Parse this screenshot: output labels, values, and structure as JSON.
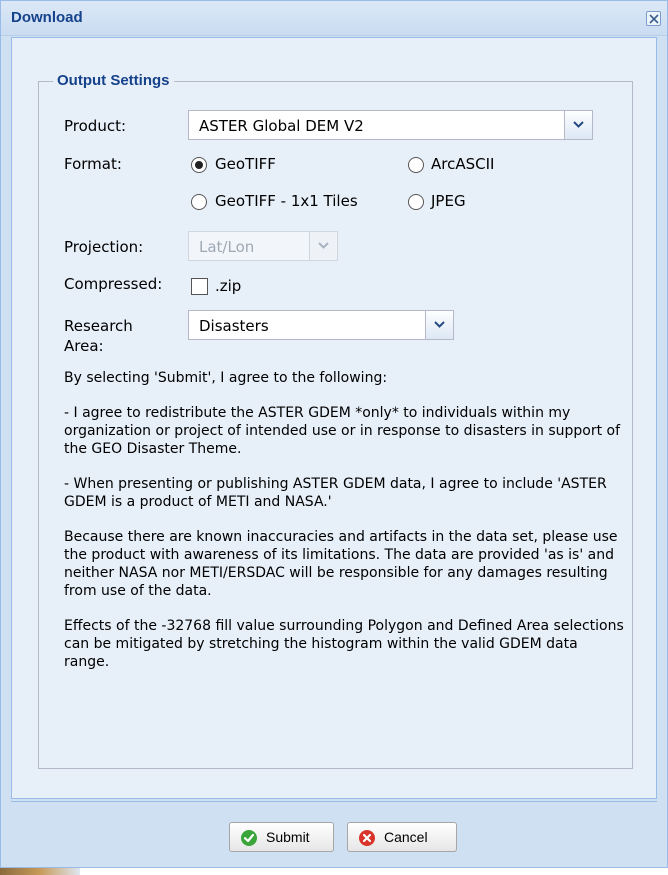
{
  "window": {
    "title": "Download",
    "close_icon": "close-icon"
  },
  "fieldset": {
    "legend": "Output Settings"
  },
  "product": {
    "label": "Product:",
    "value": "ASTER Global DEM V2"
  },
  "format": {
    "label": "Format:",
    "options": [
      {
        "label": "GeoTIFF",
        "selected": true
      },
      {
        "label": "ArcASCII",
        "selected": false
      },
      {
        "label": "GeoTIFF - 1x1 Tiles",
        "selected": false
      },
      {
        "label": "JPEG",
        "selected": false
      }
    ]
  },
  "projection": {
    "label": "Projection:",
    "value": "Lat/Lon",
    "disabled": true
  },
  "compressed": {
    "label": "Compressed:",
    "option_label": ".zip",
    "checked": false
  },
  "research_area": {
    "label_line1": "Research",
    "label_line2": "Area:",
    "value": "Disasters"
  },
  "agreement": [
    "By selecting 'Submit', I agree to the following:",
    "- I agree to redistribute the ASTER GDEM *only* to individuals within my organization or project of intended use or in response to disasters in support of the GEO Disaster Theme.",
    "- When presenting or publishing ASTER GDEM data, I agree to include 'ASTER GDEM is a product of METI and NASA.'",
    "Because there are known inaccuracies and artifacts in the data set, please use the product with awareness of its limitations. The data are provided 'as is' and neither NASA nor METI/ERSDAC will be responsible for any damages resulting from use of the data.",
    "Effects of the -32768 fill value surrounding Polygon and Defined Area selections can be mitigated by stretching the histogram within the valid GDEM data range."
  ],
  "buttons": {
    "submit": "Submit",
    "cancel": "Cancel"
  },
  "colors": {
    "title_text": "#15428b",
    "window_bg": "#cfe0f3",
    "body_bg": "#e7eff9",
    "submit_icon": "#3aa53a",
    "cancel_icon": "#d9342b"
  }
}
